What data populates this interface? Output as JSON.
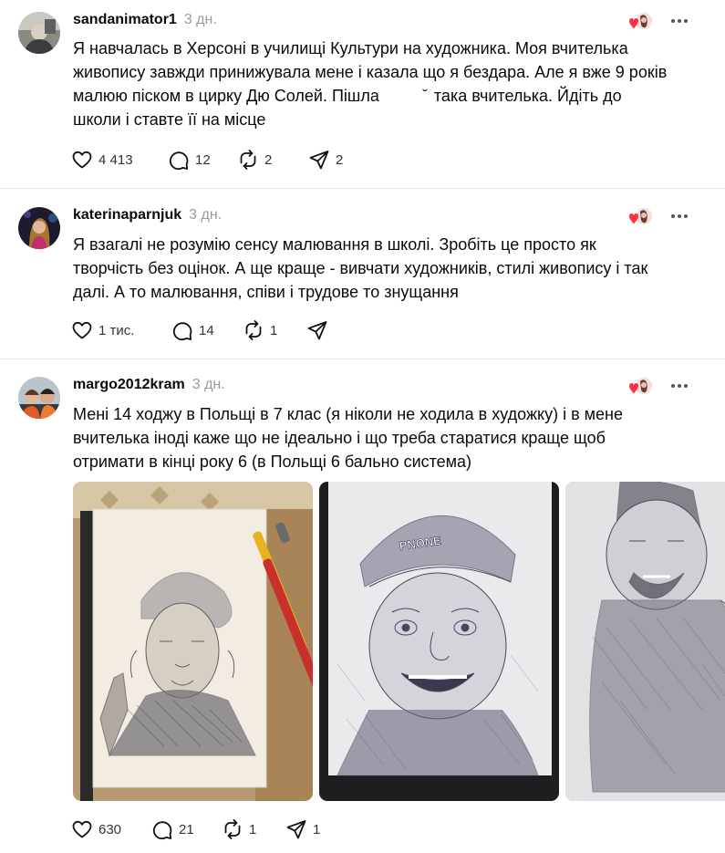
{
  "posts": [
    {
      "username": "sandanimator1",
      "time": "3 дн.",
      "text_lines": [
        "Я навчалась в Херсоні в училищі Культури на художника. Моя вчителька",
        "живопису завжди принижувала мене і казала що я бездара. Але я вже 9 років",
        "малюю піском в цирку Дю Солей. Пішла          ̆  така вчителька. Йдіть до",
        "школи і ставте її на місце"
      ],
      "likes": "4 413",
      "replies": "12",
      "reposts": "2",
      "shares": "2"
    },
    {
      "username": "katerinaparnjuk",
      "time": "3 дн.",
      "text_lines": [
        "Я взагалі не розумію сенсу малювання в школі. Зробіть це просто як",
        "творчість без оцінок. А ще краще - вивчати художників, стилі живопису і так",
        "далі. А то малювання, співи і трудове то знущання"
      ],
      "likes": "1 тис.",
      "replies": "14",
      "reposts": "1",
      "shares": ""
    },
    {
      "username": "margo2012kram",
      "time": "3 дн.",
      "text_lines": [
        "Мені 14 ходжу в Польщі в 7 клас (я ніколи не ходила в художку) і в мене",
        "вчителька іноді каже що не ідеально і що треба старатися краще щоб",
        "отримати в кінці року 6 (в Польщі 6 бально система)"
      ],
      "hat_text": "PNONE",
      "likes": "630",
      "replies": "21",
      "reposts": "1",
      "shares": "1"
    }
  ],
  "icons": {
    "like": "heart-icon",
    "reply": "comment-icon",
    "repost": "repost-icon",
    "share": "send-icon",
    "more": "more-horizontal-icon",
    "reaction": "liked-by-author-icon"
  },
  "colors": {
    "text": "#0a0a0a",
    "muted": "#9a9a9a",
    "divider": "#e3e3e3",
    "heart": "#ff3040"
  }
}
